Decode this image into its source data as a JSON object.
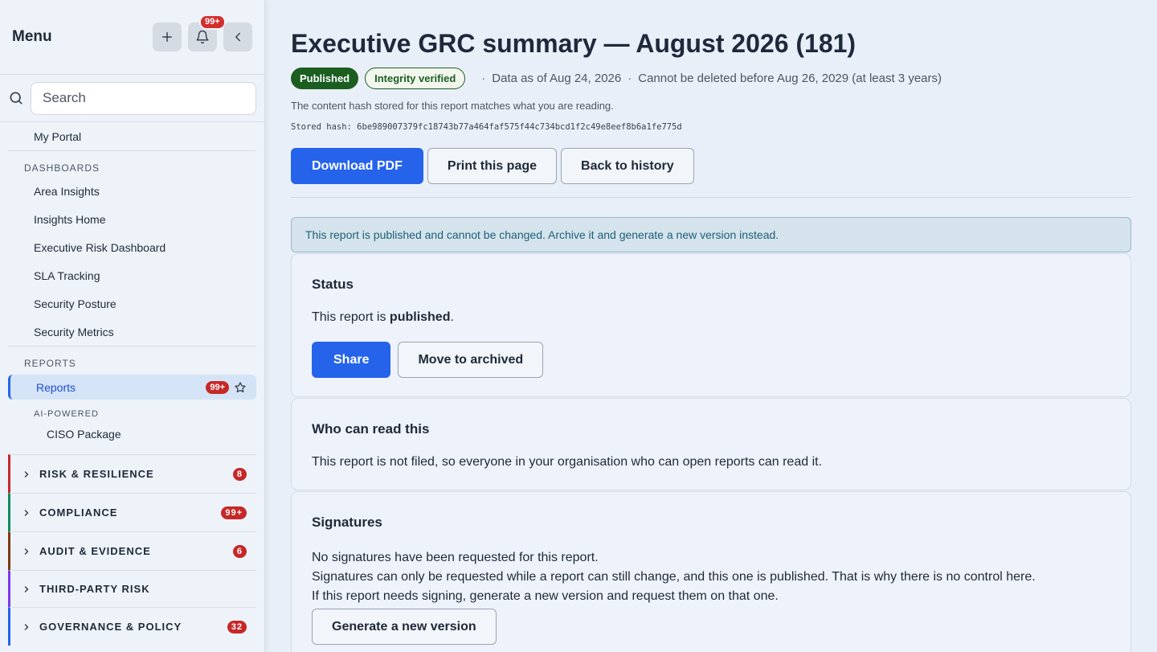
{
  "sidebar": {
    "title": "Menu",
    "notifications_count": "99+",
    "search_placeholder": "Search",
    "my_portal": "My Portal",
    "dashboards_label": "DASHBOARDS",
    "dashboards": [
      "Area Insights",
      "Insights Home",
      "Executive Risk Dashboard",
      "SLA Tracking",
      "Security Posture",
      "Security Metrics"
    ],
    "reports_label": "REPORTS",
    "reports_item": {
      "label": "Reports",
      "badge": "99+"
    },
    "ai_label": "AI-POWERED",
    "ai_items": [
      "CISO Package"
    ],
    "groups": [
      {
        "label": "RISK & RESILIENCE",
        "badge": "8",
        "color": "#c62828"
      },
      {
        "label": "COMPLIANCE",
        "badge": "99+",
        "color": "#0f8a5f"
      },
      {
        "label": "AUDIT & EVIDENCE",
        "badge": "6",
        "color": "#7c3a12"
      },
      {
        "label": "THIRD-PARTY RISK",
        "badge": "",
        "color": "#7c3aed"
      },
      {
        "label": "GOVERNANCE & POLICY",
        "badge": "32",
        "color": "#2563eb"
      }
    ]
  },
  "main": {
    "title": "Executive GRC summary — August 2026 (181)",
    "status_pill": "Published",
    "integrity_pill": "Integrity verified",
    "data_as_of": "Data as of Aug 24, 2026",
    "retention": "Cannot be deleted before Aug 26, 2029 (at least 3 years)",
    "hash_note": "The content hash stored for this report matches what you are reading.",
    "stored_hash": "Stored hash: 6be989007379fc18743b77a464faf575f44c734bcd1f2c49e8eef8b6a1fe775d",
    "buttons": {
      "download": "Download PDF",
      "print": "Print this page",
      "back": "Back to history"
    },
    "alert": "This report is published and cannot be changed. Archive it and generate a new version instead.",
    "status_card": {
      "title": "Status",
      "text_prefix": "This report is ",
      "text_bold": "published",
      "text_suffix": ".",
      "share": "Share",
      "archive": "Move to archived"
    },
    "readers_card": {
      "title": "Who can read this",
      "text": "This report is not filed, so everyone in your organisation who can open reports can read it."
    },
    "signatures_card": {
      "title": "Signatures",
      "lines": [
        "No signatures have been requested for this report.",
        "Signatures can only be requested while a report can still change, and this one is published. That is why there is no control here.",
        "If this report needs signing, generate a new version and request them on that one."
      ],
      "button": "Generate a new version"
    }
  }
}
